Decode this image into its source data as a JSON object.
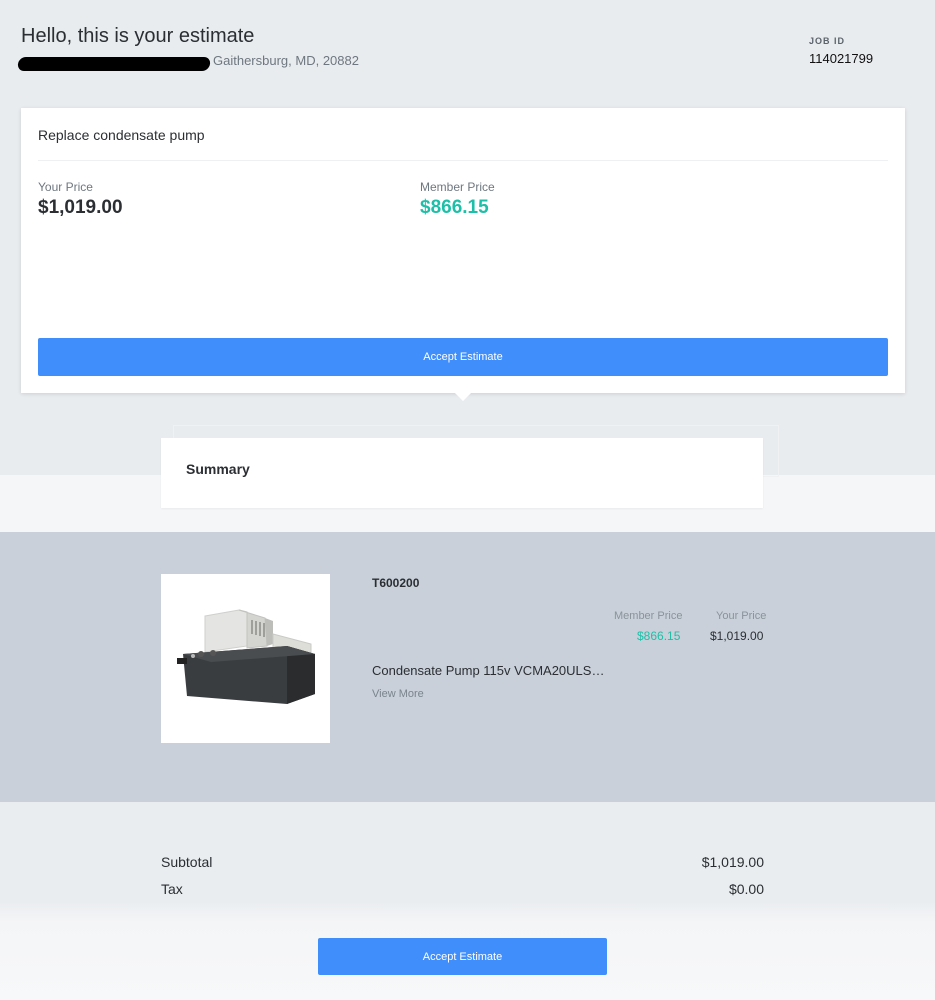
{
  "header": {
    "greeting": "Hello, this is your estimate",
    "address": "Gaithersburg, MD, 20882",
    "job_id_label": "JOB ID",
    "job_id": "114021799"
  },
  "service": {
    "title": "Replace condensate pump",
    "your_price_label": "Your Price",
    "your_price": "$1,019.00",
    "member_price_label": "Member Price",
    "member_price": "$866.15",
    "accept_label": "Accept Estimate"
  },
  "summary": {
    "title": "Summary"
  },
  "item": {
    "sku": "T600200",
    "member_price_label": "Member Price",
    "member_price": "$866.15",
    "your_price_label": "Your Price",
    "your_price": "$1,019.00",
    "description": "Condensate Pump 115v VCMA20ULS…",
    "view_more": "View More"
  },
  "totals": {
    "subtotal_label": "Subtotal",
    "subtotal": "$1,019.00",
    "tax_label": "Tax",
    "tax": "$0.00",
    "accept_label": "Accept Estimate"
  },
  "colors": {
    "accent": "#3f8efc",
    "member": "#1ebfa8"
  }
}
